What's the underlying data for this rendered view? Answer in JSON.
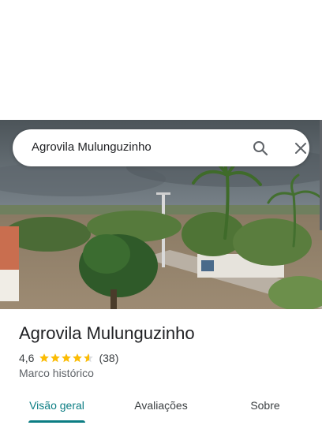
{
  "search": {
    "query": "Agrovila Mulunguzinho"
  },
  "icons": {
    "search": "search-icon",
    "close": "close-icon",
    "star": "star-icon",
    "half_star": "half-star-icon"
  },
  "place": {
    "name": "Agrovila Mulunguzinho",
    "rating": "4,6",
    "stars": 4.6,
    "review_count": "(38)",
    "category": "Marco histórico"
  },
  "tabs": [
    {
      "label": "Visão geral",
      "active": true
    },
    {
      "label": "Avaliações",
      "active": false
    },
    {
      "label": "Sobre",
      "active": false
    }
  ],
  "colors": {
    "accent": "#0b7d83",
    "star": "#fbbc04",
    "text": "#202124",
    "secondary": "#5f6368"
  }
}
